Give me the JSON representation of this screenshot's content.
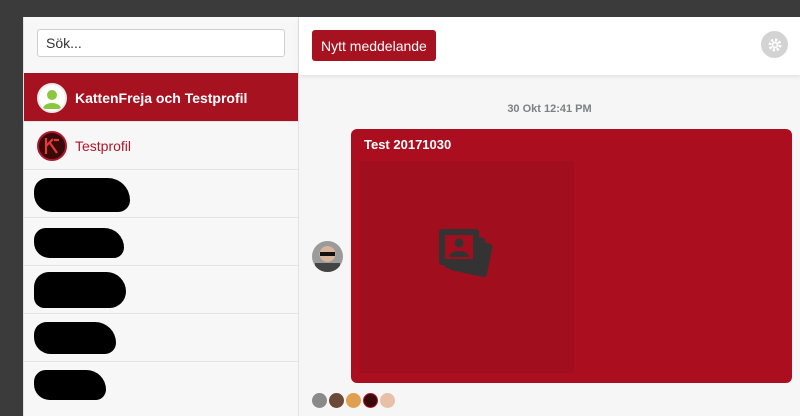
{
  "sidebar": {
    "search": {
      "placeholder": "Sök..."
    },
    "conversations": [
      {
        "label": "KattenFreja och Testprofil",
        "active": true
      },
      {
        "label": "Testprofil",
        "active": false
      },
      {
        "label": "",
        "redacted": true
      },
      {
        "label": "",
        "redacted": true
      },
      {
        "label": "",
        "redacted": true
      },
      {
        "label": "",
        "redacted": true
      },
      {
        "label": "",
        "redacted": true
      }
    ]
  },
  "toolbar": {
    "new_message_label": "Nytt meddelande",
    "settings_icon": "gear-icon"
  },
  "thread": {
    "timestamp": "30 Okt 12:41 PM",
    "message": {
      "text": "Test 20171030",
      "attachment_icon": "image-gallery-icon"
    },
    "seen_by_count": 5
  },
  "colors": {
    "accent": "#a6121f",
    "bubble": "#ab0f1f",
    "background": "#f6f6f6"
  }
}
